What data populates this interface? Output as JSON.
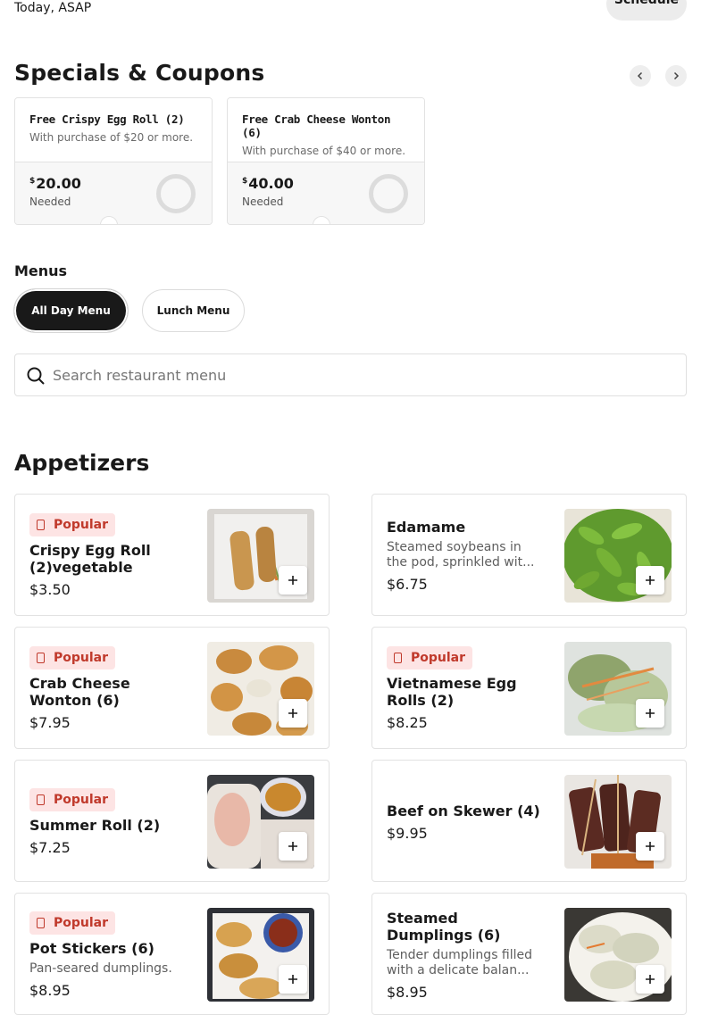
{
  "header": {
    "delivery_time": "Today, ASAP",
    "schedule_label": "Schedule"
  },
  "specials": {
    "title": "Specials & Coupons",
    "prev_icon": "chevron-left-icon",
    "next_icon": "chevron-right-icon",
    "coupons": [
      {
        "title": "Free Crispy Egg Roll (2)",
        "description": "With purchase of $20 or more.",
        "currency": "$",
        "amount": "20.00",
        "needed_label": "Needed"
      },
      {
        "title": "Free Crab Cheese Wonton (6)",
        "description": "With purchase of $40 or more.",
        "currency": "$",
        "amount": "40.00",
        "needed_label": "Needed"
      }
    ]
  },
  "menus": {
    "label": "Menus",
    "tabs": [
      {
        "label": "All Day Menu",
        "selected": true
      },
      {
        "label": "Lunch Menu",
        "selected": false
      }
    ]
  },
  "search": {
    "placeholder": "Search restaurant menu",
    "value": ""
  },
  "appetizers": {
    "title": "Appetizers",
    "popular_label": "Popular",
    "add_icon": "plus-icon",
    "items": [
      {
        "name": "Crispy Egg Roll (2)vegetable",
        "description": "",
        "price": "$3.50",
        "popular": true
      },
      {
        "name": "Edamame",
        "description": "Steamed soybeans in the pod, sprinkled wit...",
        "price": "$6.75",
        "popular": false
      },
      {
        "name": "Crab Cheese Wonton (6)",
        "description": "",
        "price": "$7.95",
        "popular": true
      },
      {
        "name": "Vietnamese Egg Rolls (2)",
        "description": "",
        "price": "$8.25",
        "popular": true
      },
      {
        "name": "Summer Roll (2)",
        "description": "",
        "price": "$7.25",
        "popular": true
      },
      {
        "name": "Beef on Skewer (4)",
        "description": "",
        "price": "$9.95",
        "popular": false
      },
      {
        "name": "Pot Stickers (6)",
        "description": "Pan-seared dumplings.",
        "price": "$8.95",
        "popular": true
      },
      {
        "name": "Steamed Dumplings (6)",
        "description": "Tender dumplings filled with a delicate balan...",
        "price": "$8.95",
        "popular": false
      }
    ]
  },
  "colors": {
    "accent_dark": "#191919",
    "popular_bg": "#fde4e4",
    "popular_text": "#c0392b"
  }
}
